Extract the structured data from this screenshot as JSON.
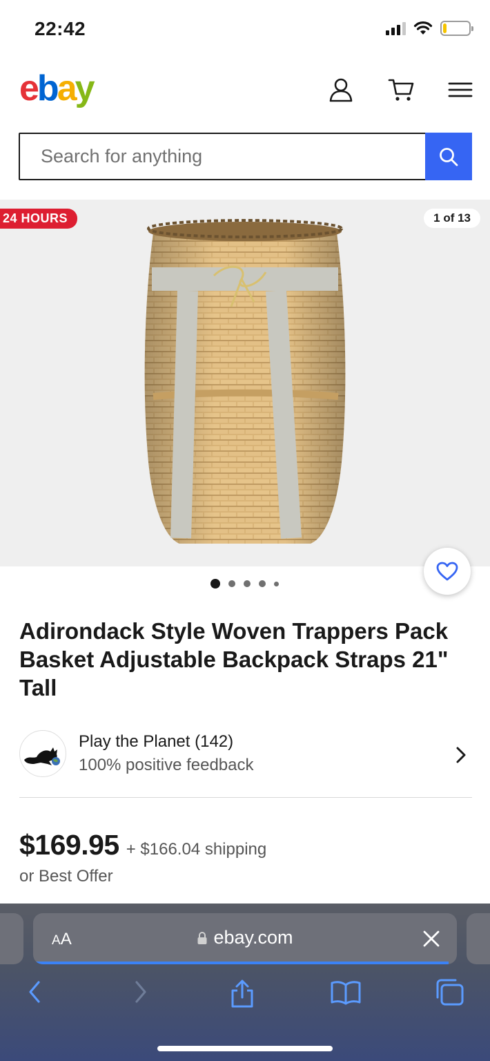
{
  "status_bar": {
    "time": "22:42",
    "battery_level": 0.15
  },
  "header": {
    "logo": {
      "e": "e",
      "b": "b",
      "a": "a",
      "y": "y"
    },
    "icons": [
      "account-icon",
      "cart-icon",
      "menu-icon"
    ]
  },
  "search": {
    "placeholder": "Search for anything",
    "value": ""
  },
  "gallery": {
    "badge": "24 HOURS",
    "counter": "1 of 13",
    "current_index": 1,
    "total_images": 13
  },
  "listing": {
    "title": "Adirondack Style Woven Trappers Pack Basket Adjustable Backpack Straps 21\" Tall",
    "seller_name": "Play the Planet (142)",
    "seller_feedback": "100% positive feedback",
    "price": "$169.95",
    "shipping": "+ $166.04 shipping",
    "best_offer": "or Best Offer"
  },
  "browser": {
    "text_size_label_small": "A",
    "text_size_label_large": "A",
    "url": "ebay.com",
    "load_progress": 0.98
  },
  "colors": {
    "ebay_red": "#e53238",
    "ebay_blue": "#0064d2",
    "ebay_yellow": "#f5af02",
    "ebay_green": "#86b817",
    "search_button": "#3665f3",
    "badge_red": "#dd1e31",
    "favorite_heart": "#3665f3"
  }
}
